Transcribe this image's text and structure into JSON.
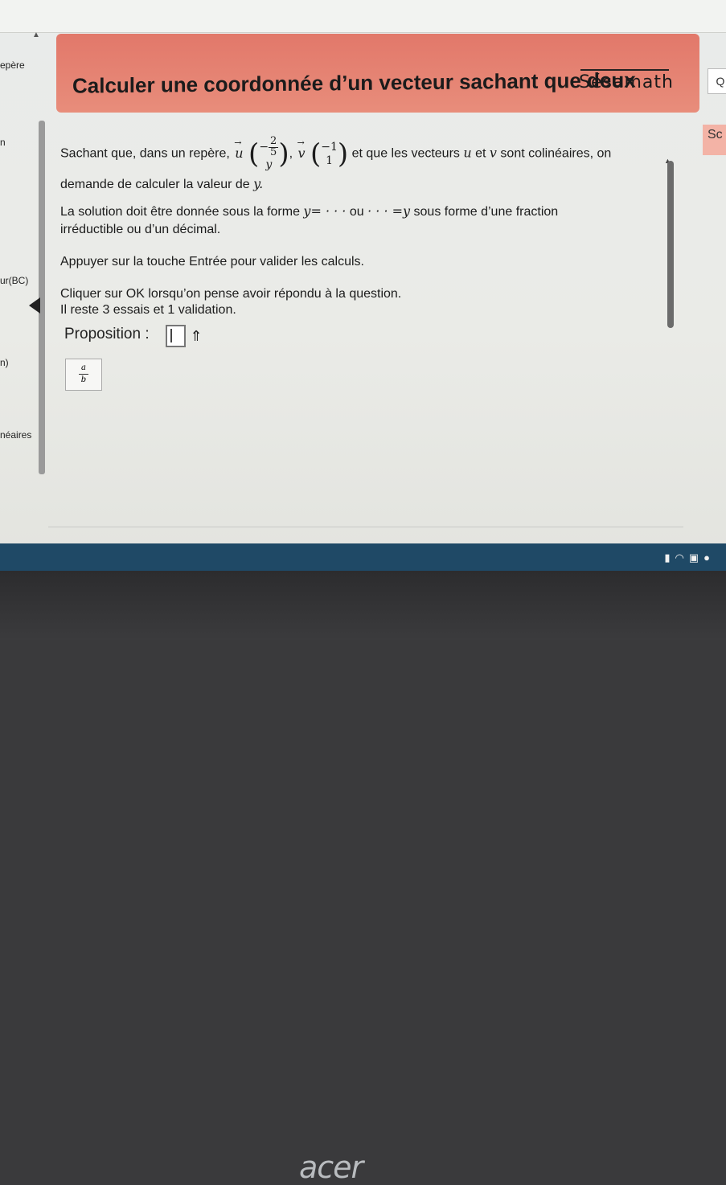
{
  "app": {
    "brand": "Sésamath",
    "title": "Calculer une coordonnée d’un vecteur sachant que deux"
  },
  "left_panel": {
    "labels": [
      "epère",
      "n",
      "ur(BC)",
      "n)",
      "néaires"
    ]
  },
  "right_tabs": {
    "tab1": "Q",
    "tab2": "Sc"
  },
  "exercise": {
    "line1_start": "Sachant que, dans un repère,",
    "vector_u": {
      "name": "u",
      "x_num": "2",
      "x_den": "5",
      "x_sign": "−",
      "y": "y"
    },
    "vector_v": {
      "name": "v",
      "x": "−1",
      "y": "1"
    },
    "line1_end": "et que les vecteurs",
    "line1_u": "u",
    "line1_and": "et",
    "line1_v": "v",
    "line1_tail": "sont colinéaires, on",
    "line2": "demande de calculer la valeur de",
    "line2_var": "y.",
    "line3_start": "La solution doit être donnée sous la forme",
    "line3_form1": "y= · · ·",
    "line3_ou": "ou",
    "line3_form2": "· · · =y",
    "line3_end": "sous forme d’une fraction",
    "line4": "irréductible ou d’un décimal.",
    "line5": "Appuyer sur la touche Entrée pour valider les calculs.",
    "line6": "Cliquer sur OK lorsqu’on pense avoir répondu à la question.",
    "line7": "Il reste 3 essais et 1 validation."
  },
  "answer": {
    "label": "Proposition :",
    "input_value": "",
    "up_button": "⇑",
    "fraction_button": {
      "num": "a",
      "den": "b"
    }
  },
  "taskbar": {
    "tray_icons": [
      "battery-icon",
      "wifi-icon",
      "notification-icon",
      "info-icon"
    ]
  },
  "laptop": {
    "logo": "acer"
  }
}
